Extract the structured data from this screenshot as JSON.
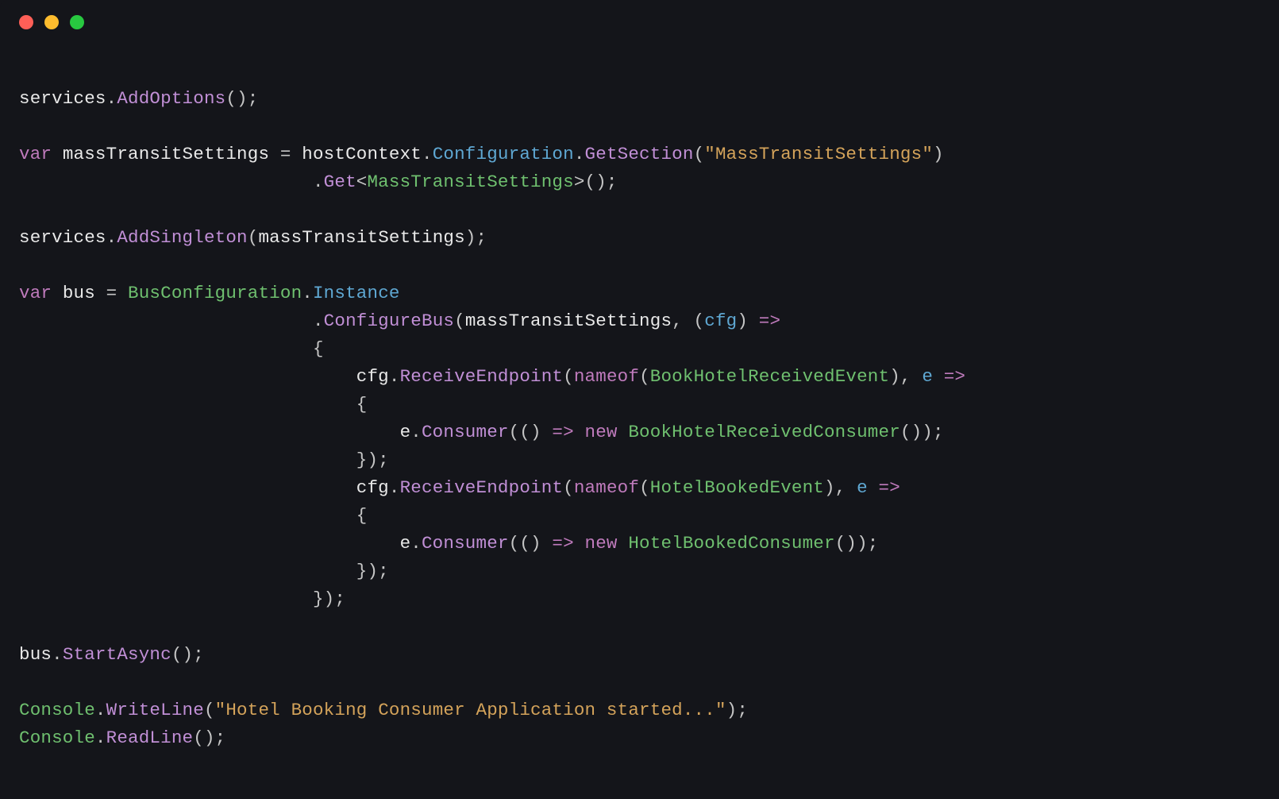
{
  "titlebar": {
    "buttons": [
      "close",
      "minimize",
      "zoom"
    ]
  },
  "code": {
    "tokens": [
      [],
      [
        {
          "c": "id",
          "t": "services"
        },
        {
          "c": "punc",
          "t": "."
        },
        {
          "c": "meth",
          "t": "AddOptions"
        },
        {
          "c": "punc",
          "t": "();"
        }
      ],
      [],
      [
        {
          "c": "kw",
          "t": "var"
        },
        {
          "c": "punc",
          "t": " "
        },
        {
          "c": "id",
          "t": "massTransitSettings"
        },
        {
          "c": "punc",
          "t": " = "
        },
        {
          "c": "id",
          "t": "hostContext"
        },
        {
          "c": "punc",
          "t": "."
        },
        {
          "c": "prop",
          "t": "Configuration"
        },
        {
          "c": "punc",
          "t": "."
        },
        {
          "c": "meth",
          "t": "GetSection"
        },
        {
          "c": "punc",
          "t": "("
        },
        {
          "c": "str",
          "t": "\"MassTransitSettings\""
        },
        {
          "c": "punc",
          "t": ")"
        }
      ],
      [
        {
          "c": "punc",
          "t": "                           ."
        },
        {
          "c": "meth",
          "t": "Get"
        },
        {
          "c": "punc",
          "t": "<"
        },
        {
          "c": "type",
          "t": "MassTransitSettings"
        },
        {
          "c": "punc",
          "t": ">();"
        }
      ],
      [],
      [
        {
          "c": "id",
          "t": "services"
        },
        {
          "c": "punc",
          "t": "."
        },
        {
          "c": "meth",
          "t": "AddSingleton"
        },
        {
          "c": "punc",
          "t": "("
        },
        {
          "c": "id",
          "t": "massTransitSettings"
        },
        {
          "c": "punc",
          "t": ");"
        }
      ],
      [],
      [
        {
          "c": "kw",
          "t": "var"
        },
        {
          "c": "punc",
          "t": " "
        },
        {
          "c": "id",
          "t": "bus"
        },
        {
          "c": "punc",
          "t": " = "
        },
        {
          "c": "type",
          "t": "BusConfiguration"
        },
        {
          "c": "punc",
          "t": "."
        },
        {
          "c": "prop",
          "t": "Instance"
        }
      ],
      [
        {
          "c": "punc",
          "t": "                           ."
        },
        {
          "c": "meth",
          "t": "ConfigureBus"
        },
        {
          "c": "punc",
          "t": "("
        },
        {
          "c": "id",
          "t": "massTransitSettings"
        },
        {
          "c": "punc",
          "t": ", ("
        },
        {
          "c": "par",
          "t": "cfg"
        },
        {
          "c": "punc",
          "t": ") "
        },
        {
          "c": "lambda",
          "t": "=>"
        }
      ],
      [
        {
          "c": "punc",
          "t": "                           {"
        }
      ],
      [
        {
          "c": "punc",
          "t": "                               "
        },
        {
          "c": "id",
          "t": "cfg"
        },
        {
          "c": "punc",
          "t": "."
        },
        {
          "c": "meth",
          "t": "ReceiveEndpoint"
        },
        {
          "c": "punc",
          "t": "("
        },
        {
          "c": "kw",
          "t": "nameof"
        },
        {
          "c": "punc",
          "t": "("
        },
        {
          "c": "type",
          "t": "BookHotelReceivedEvent"
        },
        {
          "c": "punc",
          "t": "), "
        },
        {
          "c": "par",
          "t": "e"
        },
        {
          "c": "punc",
          "t": " "
        },
        {
          "c": "lambda",
          "t": "=>"
        }
      ],
      [
        {
          "c": "punc",
          "t": "                               {"
        }
      ],
      [
        {
          "c": "punc",
          "t": "                                   "
        },
        {
          "c": "id",
          "t": "e"
        },
        {
          "c": "punc",
          "t": "."
        },
        {
          "c": "meth",
          "t": "Consumer"
        },
        {
          "c": "punc",
          "t": "(() "
        },
        {
          "c": "lambda",
          "t": "=>"
        },
        {
          "c": "punc",
          "t": " "
        },
        {
          "c": "kw",
          "t": "new"
        },
        {
          "c": "punc",
          "t": " "
        },
        {
          "c": "type",
          "t": "BookHotelReceivedConsumer"
        },
        {
          "c": "punc",
          "t": "());"
        }
      ],
      [
        {
          "c": "punc",
          "t": "                               });"
        }
      ],
      [
        {
          "c": "punc",
          "t": "                               "
        },
        {
          "c": "id",
          "t": "cfg"
        },
        {
          "c": "punc",
          "t": "."
        },
        {
          "c": "meth",
          "t": "ReceiveEndpoint"
        },
        {
          "c": "punc",
          "t": "("
        },
        {
          "c": "kw",
          "t": "nameof"
        },
        {
          "c": "punc",
          "t": "("
        },
        {
          "c": "type",
          "t": "HotelBookedEvent"
        },
        {
          "c": "punc",
          "t": "), "
        },
        {
          "c": "par",
          "t": "e"
        },
        {
          "c": "punc",
          "t": " "
        },
        {
          "c": "lambda",
          "t": "=>"
        }
      ],
      [
        {
          "c": "punc",
          "t": "                               {"
        }
      ],
      [
        {
          "c": "punc",
          "t": "                                   "
        },
        {
          "c": "id",
          "t": "e"
        },
        {
          "c": "punc",
          "t": "."
        },
        {
          "c": "meth",
          "t": "Consumer"
        },
        {
          "c": "punc",
          "t": "(() "
        },
        {
          "c": "lambda",
          "t": "=>"
        },
        {
          "c": "punc",
          "t": " "
        },
        {
          "c": "kw",
          "t": "new"
        },
        {
          "c": "punc",
          "t": " "
        },
        {
          "c": "type",
          "t": "HotelBookedConsumer"
        },
        {
          "c": "punc",
          "t": "());"
        }
      ],
      [
        {
          "c": "punc",
          "t": "                               });"
        }
      ],
      [
        {
          "c": "punc",
          "t": "                           });"
        }
      ],
      [],
      [
        {
          "c": "id",
          "t": "bus"
        },
        {
          "c": "punc",
          "t": "."
        },
        {
          "c": "meth",
          "t": "StartAsync"
        },
        {
          "c": "punc",
          "t": "();"
        }
      ],
      [],
      [
        {
          "c": "type",
          "t": "Console"
        },
        {
          "c": "punc",
          "t": "."
        },
        {
          "c": "meth",
          "t": "WriteLine"
        },
        {
          "c": "punc",
          "t": "("
        },
        {
          "c": "str",
          "t": "\"Hotel Booking Consumer Application started...\""
        },
        {
          "c": "punc",
          "t": ");"
        }
      ],
      [
        {
          "c": "type",
          "t": "Console"
        },
        {
          "c": "punc",
          "t": "."
        },
        {
          "c": "meth",
          "t": "ReadLine"
        },
        {
          "c": "punc",
          "t": "();"
        }
      ]
    ]
  }
}
